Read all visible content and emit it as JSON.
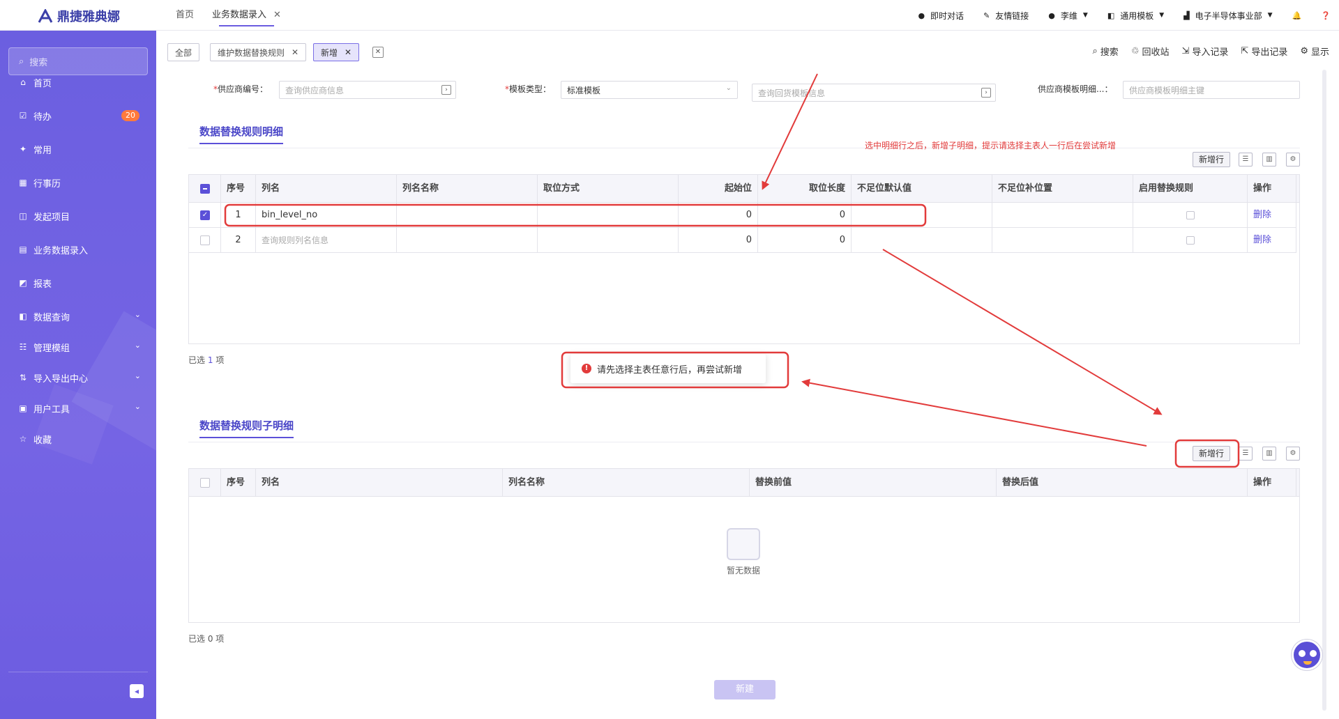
{
  "header": {
    "logo_text": "鼎捷雅典娜",
    "tabs": [
      {
        "label": "首页",
        "active": false
      },
      {
        "label": "业务数据录入",
        "active": true
      }
    ],
    "right": [
      {
        "icon": "chat-icon",
        "label": "即时对话"
      },
      {
        "icon": "link-icon",
        "label": "友情链接"
      },
      {
        "icon": "user-icon",
        "label": "李维"
      },
      {
        "icon": "template-icon",
        "label": "通用模板"
      },
      {
        "icon": "building-icon",
        "label": "电子半导体事业部"
      },
      {
        "icon": "bell-icon",
        "label": ""
      },
      {
        "icon": "help-icon",
        "label": ""
      }
    ]
  },
  "sidebar": {
    "search_placeholder": "搜索",
    "items": [
      {
        "label": "首页",
        "icon": "home-icon"
      },
      {
        "label": "待办",
        "icon": "todo-icon",
        "badge": "20"
      },
      {
        "label": "常用",
        "icon": "pin-icon"
      },
      {
        "label": "行事历",
        "icon": "calendar-icon"
      },
      {
        "label": "发起项目",
        "icon": "project-icon"
      },
      {
        "label": "业务数据录入",
        "icon": "data-entry-icon"
      },
      {
        "label": "报表",
        "icon": "report-icon"
      },
      {
        "label": "数据查询",
        "icon": "query-icon",
        "expandable": true
      },
      {
        "label": "管理模组",
        "icon": "module-icon",
        "expandable": true
      },
      {
        "label": "导入导出中心",
        "icon": "import-export-icon",
        "expandable": true
      },
      {
        "label": "用户工具",
        "icon": "tools-icon",
        "expandable": true
      },
      {
        "label": "收藏",
        "icon": "star-icon"
      }
    ]
  },
  "page_tabs": [
    {
      "label": "全部",
      "closable": false,
      "active": false
    },
    {
      "label": "维护数据替换规则",
      "closable": true,
      "active": false
    },
    {
      "label": "新增",
      "closable": true,
      "active": true
    }
  ],
  "toolbar": [
    {
      "icon": "search-icon",
      "label": "搜索"
    },
    {
      "icon": "recycle-icon",
      "label": "回收站"
    },
    {
      "icon": "import-icon",
      "label": "导入记录"
    },
    {
      "icon": "export-icon",
      "label": "导出记录"
    },
    {
      "icon": "display-icon",
      "label": "显示"
    }
  ],
  "form": {
    "supplier_label": "供应商编号：",
    "supplier_placeholder": "查询供应商信息",
    "template_type_label": "模板类型：",
    "template_type_value": "标准模板",
    "return_template_placeholder": "查询回货模板信息",
    "supplier_template_label": "供应商模板明细...：",
    "supplier_template_placeholder": "供应商模板明细主键"
  },
  "detail_section": {
    "title": "数据替换规则明细",
    "annotation": "选中明细行之后，新增子明细，提示请选择主表人一行后在尝试新增",
    "add_row_label": "新增行",
    "columns": [
      "序号",
      "列名",
      "列名名称",
      "取位方式",
      "起始位",
      "取位长度",
      "不足位默认值",
      "不足位补位置",
      "启用替换规则",
      "操作"
    ],
    "rows": [
      {
        "checked": true,
        "seq": "1",
        "col_name": "bin_level_no",
        "col_name_placeholder": false,
        "col_title": "",
        "mode": "",
        "start": "0",
        "length": "0",
        "default_val": "",
        "pad_pos": "",
        "enabled": false,
        "action": "删除"
      },
      {
        "checked": false,
        "seq": "2",
        "col_name": "查询规则列名信息",
        "col_name_placeholder": true,
        "col_title": "",
        "mode": "",
        "start": "0",
        "length": "0",
        "default_val": "",
        "pad_pos": "",
        "enabled": false,
        "action": "删除"
      }
    ],
    "selected_prefix": "已选",
    "selected_count": "1",
    "selected_suffix": "项"
  },
  "toast": {
    "message": "请先选择主表任意行后，再尝试新增"
  },
  "sub_section": {
    "title": "数据替换规则子明细",
    "add_row_label": "新增行",
    "columns": [
      "序号",
      "列名",
      "列名名称",
      "替换前值",
      "替换后值",
      "操作"
    ],
    "empty_text": "暂无数据",
    "selected_text": "已选 0 项"
  },
  "footer": {
    "new_button": "新建"
  },
  "colors": {
    "sidebar": "#6b5fe0",
    "accent": "#5b50d8",
    "annotation_red": "#e23b3b"
  }
}
